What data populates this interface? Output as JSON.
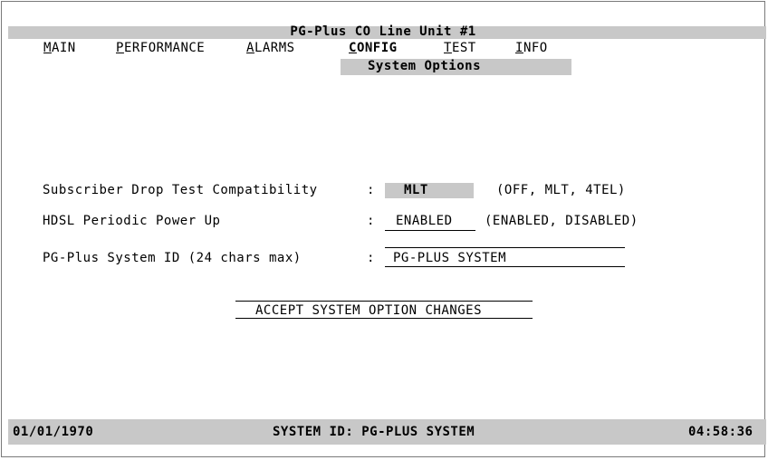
{
  "window": {
    "title": "PG-Plus CO Line Unit #1"
  },
  "menu": {
    "items": [
      {
        "label": "MAIN",
        "hotkey": "M"
      },
      {
        "label": "PERFORMANCE",
        "hotkey": "P"
      },
      {
        "label": "ALARMS",
        "hotkey": "A"
      },
      {
        "label": "CONFIG",
        "hotkey": "C",
        "active": true
      },
      {
        "label": "TEST",
        "hotkey": "T"
      },
      {
        "label": "INFO",
        "hotkey": "I"
      }
    ],
    "submenu_title": "System Options"
  },
  "options": {
    "drop_test": {
      "label": "Subscriber Drop Test Compatibility",
      "value": "MLT",
      "choices": "(OFF, MLT, 4TEL)"
    },
    "hdsl_power": {
      "label": "HDSL Periodic Power Up",
      "value": "ENABLED",
      "choices": "(ENABLED, DISABLED)"
    },
    "system_id": {
      "label": "PG-Plus System ID (24 chars max)",
      "value": "PG-PLUS SYSTEM"
    },
    "separator": ":"
  },
  "actions": {
    "accept": "ACCEPT SYSTEM OPTION CHANGES"
  },
  "status": {
    "date": "01/01/1970",
    "system_id": "SYSTEM ID: PG-PLUS SYSTEM",
    "time": "04:58:36"
  },
  "colors": {
    "bar_gray": "#c8c8c8",
    "text": "#000000",
    "background": "#ffffff"
  }
}
